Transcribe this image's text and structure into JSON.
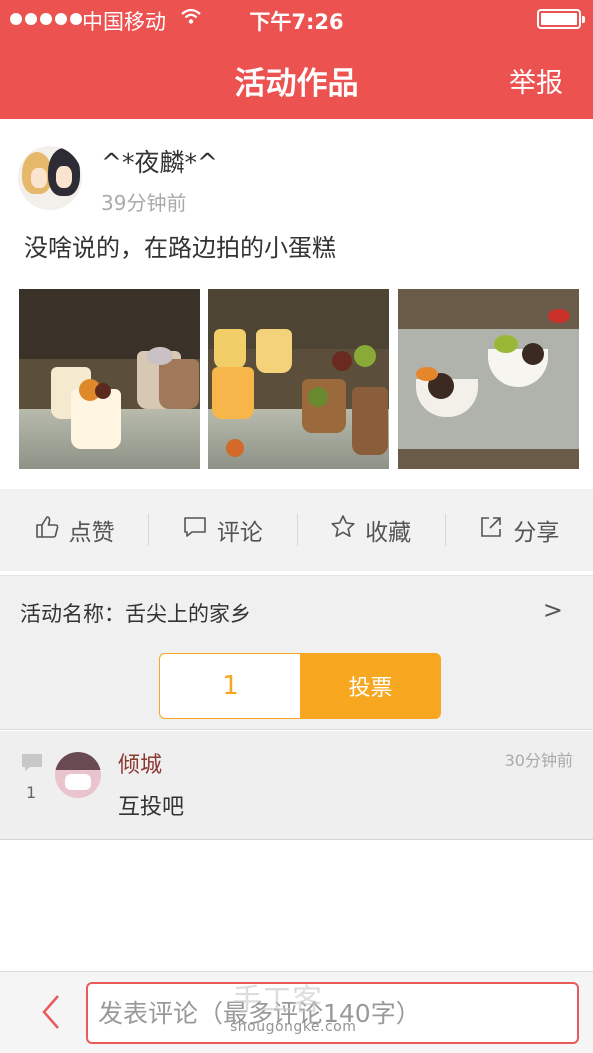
{
  "status_bar": {
    "carrier": "中国移动",
    "time": "下午7:26"
  },
  "header": {
    "title": "活动作品",
    "report_label": "举报"
  },
  "post": {
    "username": "^*夜麟*^",
    "time_ago": "39分钟前",
    "content": "没啥说的，在路边拍的小蛋糕",
    "photos": [
      "cake-photo-1",
      "cake-photo-2",
      "cake-photo-3"
    ]
  },
  "actions": [
    {
      "label": "点赞",
      "icon": "thumbs-up-icon"
    },
    {
      "label": "评论",
      "icon": "comment-icon"
    },
    {
      "label": "收藏",
      "icon": "star-icon"
    },
    {
      "label": "分享",
      "icon": "share-icon"
    }
  ],
  "event": {
    "name": "活动名称：舌尖上的家乡",
    "chevron": ">",
    "vote_count": "1",
    "vote_label": "投票"
  },
  "comments": [
    {
      "count": "1",
      "author": "倾城",
      "time": "30分钟前",
      "text": "互投吧"
    }
  ],
  "bottom_bar": {
    "input_placeholder": "发表评论（最多评论140字）"
  },
  "watermark": {
    "brand": "手工客",
    "domain": "shougongke.com"
  },
  "colors": {
    "header_red": "#ec5250",
    "vote_orange": "#f7a820",
    "input_border": "#e95b5b"
  }
}
